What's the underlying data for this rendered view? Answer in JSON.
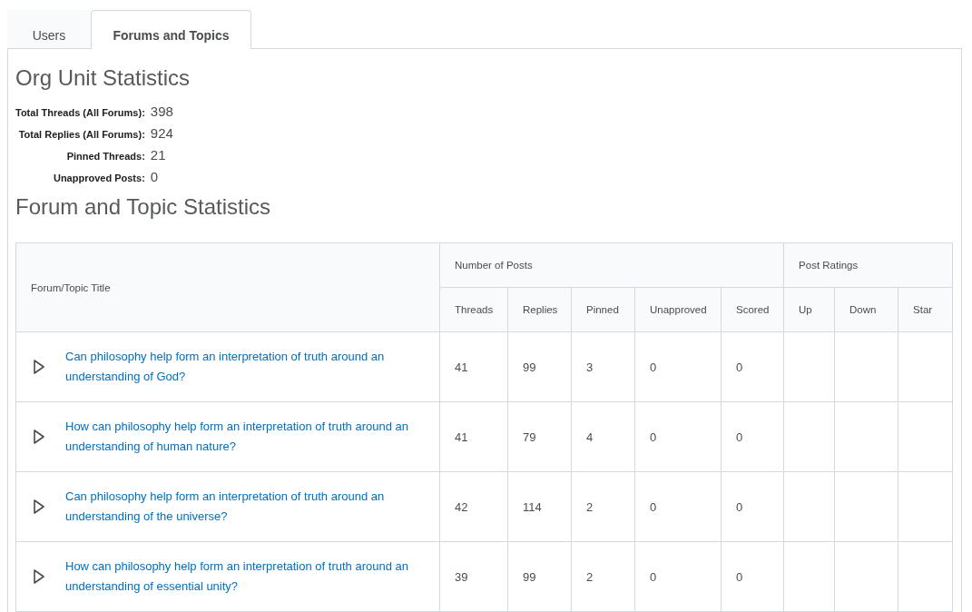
{
  "tabs": [
    {
      "label": "Users",
      "selected": false
    },
    {
      "label": "Forums and Topics",
      "selected": true
    }
  ],
  "org_unit": {
    "heading": "Org Unit Statistics",
    "stats": [
      {
        "label": "Total Threads (All Forums):",
        "value": "398"
      },
      {
        "label": "Total Replies (All Forums):",
        "value": "924"
      },
      {
        "label": "Pinned Threads:",
        "value": "21"
      },
      {
        "label": "Unapproved Posts:",
        "value": "0"
      }
    ]
  },
  "forum_stats": {
    "heading": "Forum and Topic Statistics",
    "table": {
      "title_column": "Forum/Topic Title",
      "groups": [
        {
          "label": "Number of Posts",
          "columns": [
            "Threads",
            "Replies",
            "Pinned",
            "Unapproved",
            "Scored"
          ]
        },
        {
          "label": "Post Ratings",
          "columns": [
            "Up",
            "Down",
            "Star"
          ]
        }
      ],
      "rows": [
        {
          "title": "Can philosophy help form an interpretation of truth around an understanding of God?",
          "expanded": false,
          "cells": [
            "41",
            "99",
            "3",
            "0",
            "0"
          ]
        },
        {
          "title": "How can philosophy help form an interpretation of truth around an understanding of human nature?",
          "expanded": false,
          "cells": [
            "41",
            "79",
            "4",
            "0",
            "0"
          ]
        },
        {
          "title": "Can philosophy help form an interpretation of truth around an understanding of the universe?",
          "expanded": false,
          "cells": [
            "42",
            "114",
            "2",
            "0",
            "0"
          ]
        },
        {
          "title": "How can philosophy help form an interpretation of truth around an understanding of essential unity?",
          "expanded": false,
          "cells": [
            "39",
            "99",
            "2",
            "0",
            "0"
          ]
        }
      ]
    }
  }
}
